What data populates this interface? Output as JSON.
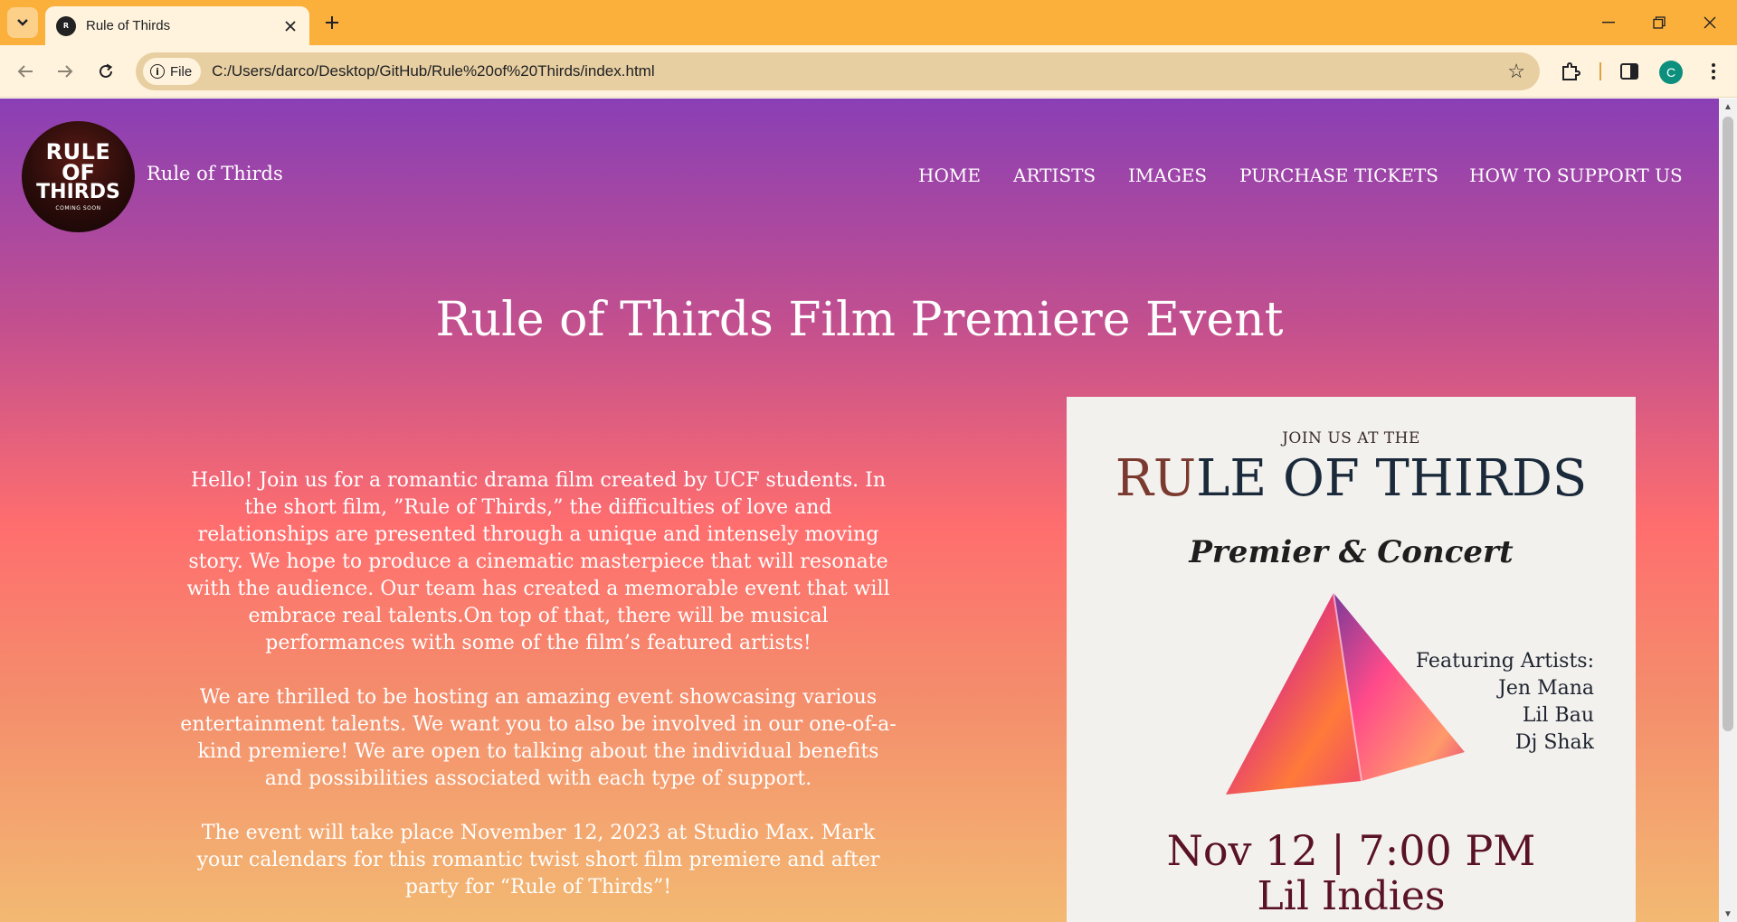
{
  "browser": {
    "tab_title": "Rule of Thirds",
    "file_chip": "File",
    "url": "C:/Users/darco/Desktop/GitHub/Rule%20of%20Thirds/index.html",
    "profile_initial": "C",
    "accent_color": "#fbb03b"
  },
  "site": {
    "logo": {
      "line1": "RULE",
      "line2": "OF",
      "line3": "THIRDS",
      "line4": "COMING SOON"
    },
    "name": "Rule of Thirds",
    "nav": [
      "HOME",
      "ARTISTS",
      "IMAGES",
      "PURCHASE TICKETS",
      "HOW TO SUPPORT US"
    ]
  },
  "main": {
    "title": "Rule of Thirds Film Premiere Event",
    "paragraphs": [
      "Hello! Join us for a romantic drama film created by UCF students. In the short film, ”Rule of Thirds,” the difficulties of love and relationships are presented through a unique and intensely moving story. We hope to produce a cinematic masterpiece that will resonate with the audience. Our team has created a memorable event that will embrace real talents.On top of that, there will be musical performances with some of the film’s featured artists!",
      "We are thrilled to be hosting an amazing event showcasing various entertainment talents. We want you to also be involved in our one-of-a-kind premiere! We are open to talking about the individual benefits and possibilities associated with each type of support.",
      "The event will take place November 12, 2023 at Studio Max. Mark your calendars for this romantic twist short film premiere and after party for “Rule of Thirds”!"
    ]
  },
  "poster": {
    "join": "JOIN US AT THE",
    "title_a": "RU",
    "title_b": "LE OF THIRDS",
    "subtitle": "Premier & Concert",
    "featuring": "Featuring Artists:",
    "artists": [
      "Jen Mana",
      "Lil Bau",
      "Dj Shak"
    ],
    "date": "Nov 12 | 7:00 PM",
    "venue": "Lil Indies"
  }
}
